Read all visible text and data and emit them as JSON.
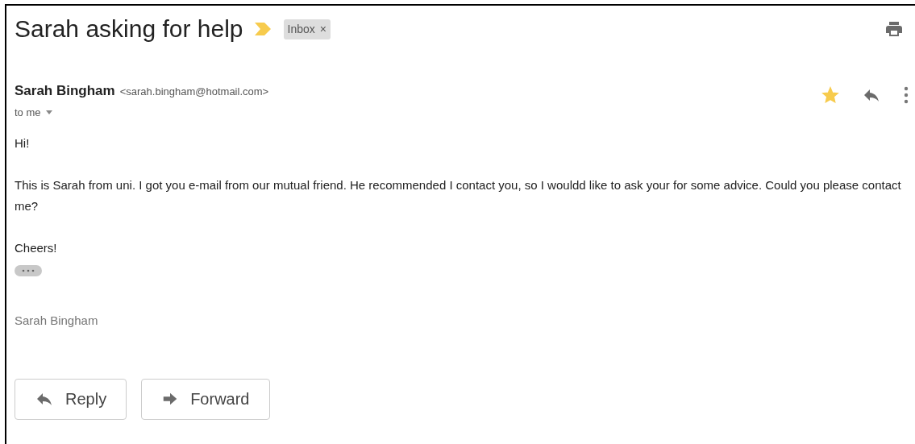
{
  "subject": "Sarah asking for help",
  "important": true,
  "labels": [
    {
      "text": "Inbox",
      "close": "×"
    }
  ],
  "sender": {
    "name": "Sarah Bingham",
    "email": "<sarah.bingham@hotmail.com>",
    "recipient": "to me",
    "starred": true
  },
  "body": [
    "Hi!",
    "This is Sarah from uni. I got you e-mail from our mutual friend. He recommended I contact you, so I wouldd like to ask your for some advice. Could you please contact me?",
    "Cheers!"
  ],
  "signature": "Sarah Bingham",
  "buttons": [
    {
      "kind": "reply",
      "label": "Reply"
    },
    {
      "kind": "forward",
      "label": "Forward"
    }
  ]
}
